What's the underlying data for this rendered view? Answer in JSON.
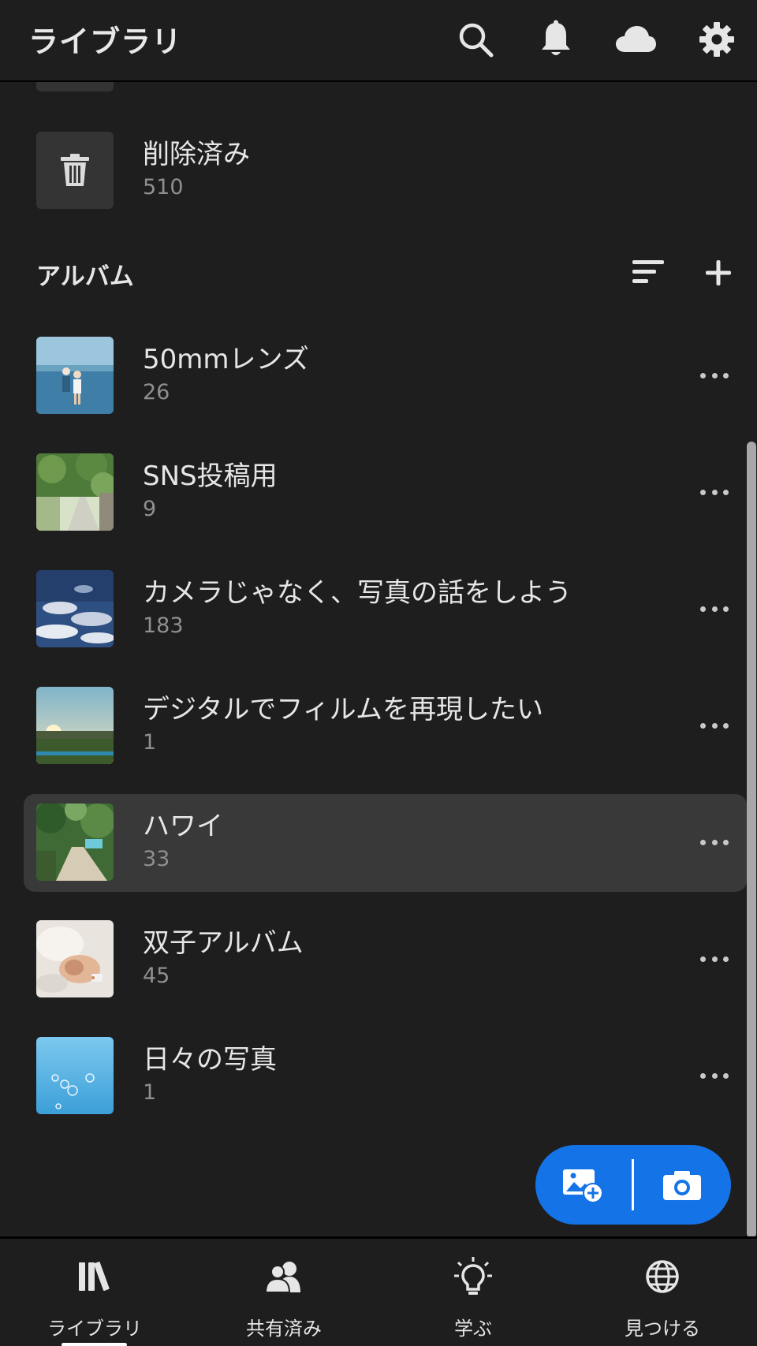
{
  "header": {
    "title": "ライブラリ",
    "icons": [
      "search-icon",
      "bell-icon",
      "cloud-icon",
      "gear-icon"
    ]
  },
  "deleted": {
    "title": "削除済み",
    "count": "510",
    "icon": "trash-icon"
  },
  "albums_section": {
    "title": "アルバム",
    "icons": [
      "sort-icon",
      "add-icon"
    ]
  },
  "albums": [
    {
      "title": "50mmレンズ",
      "count": "26"
    },
    {
      "title": "SNS投稿用",
      "count": "9"
    },
    {
      "title": "カメラじゃなく、写真の話をしよう",
      "count": "183"
    },
    {
      "title": "デジタルでフィルムを再現したい",
      "count": "1"
    },
    {
      "title": "ハワイ",
      "count": "33"
    },
    {
      "title": "双子アルバム",
      "count": "45"
    },
    {
      "title": "日々の写真",
      "count": "1"
    }
  ],
  "fab": {
    "icons": [
      "add-photo-icon",
      "camera-icon"
    ],
    "color": "#1473e6"
  },
  "bottom_nav": {
    "items": [
      {
        "label": "ライブラリ",
        "icon": "library-icon"
      },
      {
        "label": "共有済み",
        "icon": "people-icon"
      },
      {
        "label": "学ぶ",
        "icon": "lightbulb-icon"
      },
      {
        "label": "見つける",
        "icon": "globe-icon"
      }
    ],
    "active": "ライブラリ"
  }
}
